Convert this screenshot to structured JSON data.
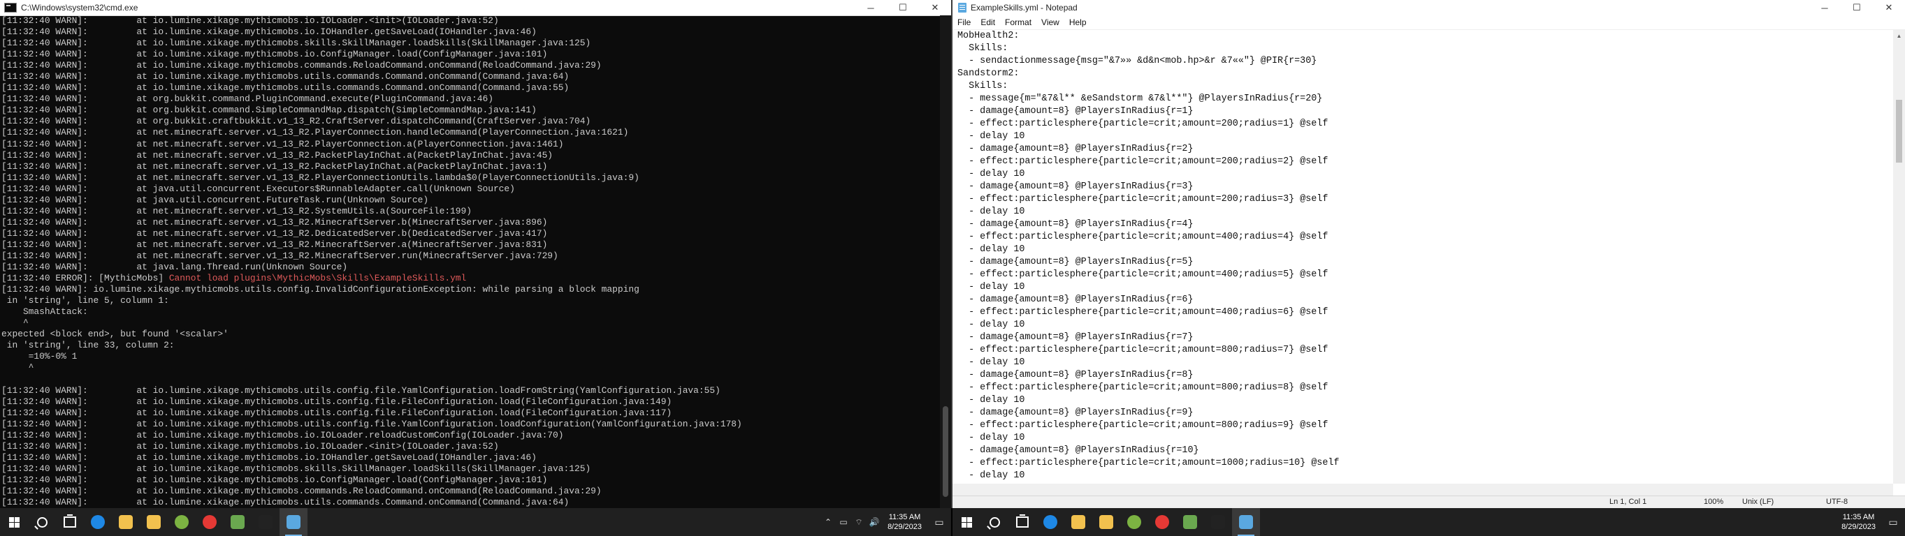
{
  "cmd": {
    "title": "C:\\Windows\\system32\\cmd.exe",
    "controls": {
      "minimize": "─",
      "maximize": "☐",
      "close": "✕"
    },
    "lines": [
      {
        "text": "[11:32:40 WARN]:         at io.lumine.xikage.mythicmobs.io.IOLoader.<init>(IOLoader.java:52)"
      },
      {
        "text": "[11:32:40 WARN]:         at io.lumine.xikage.mythicmobs.io.IOHandler.getSaveLoad(IOHandler.java:46)"
      },
      {
        "text": "[11:32:40 WARN]:         at io.lumine.xikage.mythicmobs.skills.SkillManager.loadSkills(SkillManager.java:125)"
      },
      {
        "text": "[11:32:40 WARN]:         at io.lumine.xikage.mythicmobs.io.ConfigManager.load(ConfigManager.java:101)"
      },
      {
        "text": "[11:32:40 WARN]:         at io.lumine.xikage.mythicmobs.commands.ReloadCommand.onCommand(ReloadCommand.java:29)"
      },
      {
        "text": "[11:32:40 WARN]:         at io.lumine.xikage.mythicmobs.utils.commands.Command.onCommand(Command.java:64)"
      },
      {
        "text": "[11:32:40 WARN]:         at io.lumine.xikage.mythicmobs.utils.commands.Command.onCommand(Command.java:55)"
      },
      {
        "text": "[11:32:40 WARN]:         at org.bukkit.command.PluginCommand.execute(PluginCommand.java:46)"
      },
      {
        "text": "[11:32:40 WARN]:         at org.bukkit.command.SimpleCommandMap.dispatch(SimpleCommandMap.java:141)"
      },
      {
        "text": "[11:32:40 WARN]:         at org.bukkit.craftbukkit.v1_13_R2.CraftServer.dispatchCommand(CraftServer.java:704)"
      },
      {
        "text": "[11:32:40 WARN]:         at net.minecraft.server.v1_13_R2.PlayerConnection.handleCommand(PlayerConnection.java:1621)"
      },
      {
        "text": "[11:32:40 WARN]:         at net.minecraft.server.v1_13_R2.PlayerConnection.a(PlayerConnection.java:1461)"
      },
      {
        "text": "[11:32:40 WARN]:         at net.minecraft.server.v1_13_R2.PacketPlayInChat.a(PacketPlayInChat.java:45)"
      },
      {
        "text": "[11:32:40 WARN]:         at net.minecraft.server.v1_13_R2.PacketPlayInChat.a(PacketPlayInChat.java:1)"
      },
      {
        "text": "[11:32:40 WARN]:         at net.minecraft.server.v1_13_R2.PlayerConnectionUtils.lambda$0(PlayerConnectionUtils.java:9)"
      },
      {
        "text": "[11:32:40 WARN]:         at java.util.concurrent.Executors$RunnableAdapter.call(Unknown Source)"
      },
      {
        "text": "[11:32:40 WARN]:         at java.util.concurrent.FutureTask.run(Unknown Source)"
      },
      {
        "text": "[11:32:40 WARN]:         at net.minecraft.server.v1_13_R2.SystemUtils.a(SourceFile:199)"
      },
      {
        "text": "[11:32:40 WARN]:         at net.minecraft.server.v1_13_R2.MinecraftServer.b(MinecraftServer.java:896)"
      },
      {
        "text": "[11:32:40 WARN]:         at net.minecraft.server.v1_13_R2.DedicatedServer.b(DedicatedServer.java:417)"
      },
      {
        "text": "[11:32:40 WARN]:         at net.minecraft.server.v1_13_R2.MinecraftServer.a(MinecraftServer.java:831)"
      },
      {
        "text": "[11:32:40 WARN]:         at net.minecraft.server.v1_13_R2.MinecraftServer.run(MinecraftServer.java:729)"
      },
      {
        "text": "[11:32:40 WARN]:         at java.lang.Thread.run(Unknown Source)"
      },
      {
        "text": "[11:32:40 ERROR]: [MythicMobs] ",
        "red": "Cannot load plugins\\MythicMobs\\Skills\\ExampleSkills.yml"
      },
      {
        "text": "[11:32:40 WARN]: io.lumine.xikage.mythicmobs.utils.config.InvalidConfigurationException: while parsing a block mapping"
      },
      {
        "text": " in 'string', line 5, column 1:"
      },
      {
        "text": "    SmashAttack:"
      },
      {
        "text": "    ^"
      },
      {
        "text": "expected <block end>, but found '<scalar>'"
      },
      {
        "text": " in 'string', line 33, column 2:"
      },
      {
        "text": "     =10%-0% 1"
      },
      {
        "text": "     ^"
      },
      {
        "text": ""
      },
      {
        "text": "[11:32:40 WARN]:         at io.lumine.xikage.mythicmobs.utils.config.file.YamlConfiguration.loadFromString(YamlConfiguration.java:55)"
      },
      {
        "text": "[11:32:40 WARN]:         at io.lumine.xikage.mythicmobs.utils.config.file.FileConfiguration.load(FileConfiguration.java:149)"
      },
      {
        "text": "[11:32:40 WARN]:         at io.lumine.xikage.mythicmobs.utils.config.file.FileConfiguration.load(FileConfiguration.java:117)"
      },
      {
        "text": "[11:32:40 WARN]:         at io.lumine.xikage.mythicmobs.utils.config.file.YamlConfiguration.loadConfiguration(YamlConfiguration.java:178)"
      },
      {
        "text": "[11:32:40 WARN]:         at io.lumine.xikage.mythicmobs.io.IOLoader.reloadCustomConfig(IOLoader.java:70)"
      },
      {
        "text": "[11:32:40 WARN]:         at io.lumine.xikage.mythicmobs.io.IOLoader.<init>(IOLoader.java:52)"
      },
      {
        "text": "[11:32:40 WARN]:         at io.lumine.xikage.mythicmobs.io.IOHandler.getSaveLoad(IOHandler.java:46)"
      },
      {
        "text": "[11:32:40 WARN]:         at io.lumine.xikage.mythicmobs.skills.SkillManager.loadSkills(SkillManager.java:125)"
      },
      {
        "text": "[11:32:40 WARN]:         at io.lumine.xikage.mythicmobs.io.ConfigManager.load(ConfigManager.java:101)"
      },
      {
        "text": "[11:32:40 WARN]:         at io.lumine.xikage.mythicmobs.commands.ReloadCommand.onCommand(ReloadCommand.java:29)"
      },
      {
        "text": "[11:32:40 WARN]:         at io.lumine.xikage.mythicmobs.utils.commands.Command.onCommand(Command.java:64)"
      }
    ]
  },
  "notepad": {
    "title": "ExampleSkills.yml - Notepad",
    "controls": {
      "minimize": "─",
      "maximize": "☐",
      "close": "✕"
    },
    "menu": [
      "File",
      "Edit",
      "Format",
      "View",
      "Help"
    ],
    "lines": [
      "MobHealth2:",
      "  Skills:",
      "  - sendactionmessage{msg=\"&7»» &d&n<mob.hp>&r &7««\"} @PIR{r=30}",
      "Sandstorm2:",
      "  Skills:",
      "  - message{m=\"&7&l** &eSandstorm &7&l**\"} @PlayersInRadius{r=20}",
      "  - damage{amount=8} @PlayersInRadius{r=1}",
      "  - effect:particlesphere{particle=crit;amount=200;radius=1} @self",
      "  - delay 10",
      "  - damage{amount=8} @PlayersInRadius{r=2}",
      "  - effect:particlesphere{particle=crit;amount=200;radius=2} @self",
      "  - delay 10",
      "  - damage{amount=8} @PlayersInRadius{r=3}",
      "  - effect:particlesphere{particle=crit;amount=200;radius=3} @self",
      "  - delay 10",
      "  - damage{amount=8} @PlayersInRadius{r=4}",
      "  - effect:particlesphere{particle=crit;amount=400;radius=4} @self",
      "  - delay 10",
      "  - damage{amount=8} @PlayersInRadius{r=5}",
      "  - effect:particlesphere{particle=crit;amount=400;radius=5} @self",
      "  - delay 10",
      "  - damage{amount=8} @PlayersInRadius{r=6}",
      "  - effect:particlesphere{particle=crit;amount=400;radius=6} @self",
      "  - delay 10",
      "  - damage{amount=8} @PlayersInRadius{r=7}",
      "  - effect:particlesphere{particle=crit;amount=800;radius=7} @self",
      "  - delay 10",
      "  - damage{amount=8} @PlayersInRadius{r=8}",
      "  - effect:particlesphere{particle=crit;amount=800;radius=8} @self",
      "  - delay 10",
      "  - damage{amount=8} @PlayersInRadius{r=9}",
      "  - effect:particlesphere{particle=crit;amount=800;radius=9} @self",
      "  - delay 10",
      "  - damage{amount=8} @PlayersInRadius{r=10}",
      "  - effect:particlesphere{particle=crit;amount=1000;radius=10} @self",
      "  - delay 10"
    ],
    "status": {
      "position": "Ln 1, Col 1",
      "zoom": "100%",
      "line_ending": "Unix (LF)",
      "encoding": "UTF-8"
    }
  },
  "taskbar": {
    "time": "11:35 AM",
    "date": "8/29/2023",
    "apps_left": [
      {
        "name": "edge-icon",
        "color": "#1e88e5",
        "shape": "circ"
      },
      {
        "name": "file-explorer-icon",
        "color": "#f2c14e",
        "shape": "sq"
      },
      {
        "name": "store-icon",
        "color": "#f2c14e",
        "shape": "sq"
      },
      {
        "name": "app-icon",
        "color": "#7cb342",
        "shape": "circ"
      },
      {
        "name": "chrome-icon",
        "color": "#e53935",
        "shape": "circ"
      },
      {
        "name": "minecraft-icon",
        "color": "#6aa84f",
        "shape": "sq"
      },
      {
        "name": "terminal-icon",
        "color": "#222222",
        "shape": "sq"
      },
      {
        "name": "notepad-icon",
        "color": "#5aa8e0",
        "shape": "sq"
      }
    ],
    "apps_right": [
      {
        "name": "edge-icon",
        "color": "#1e88e5",
        "shape": "circ"
      },
      {
        "name": "file-explorer-icon",
        "color": "#f2c14e",
        "shape": "sq"
      },
      {
        "name": "store-icon",
        "color": "#f2c14e",
        "shape": "sq"
      },
      {
        "name": "app-icon",
        "color": "#7cb342",
        "shape": "circ"
      },
      {
        "name": "chrome-icon",
        "color": "#e53935",
        "shape": "circ"
      },
      {
        "name": "minecraft-icon",
        "color": "#6aa84f",
        "shape": "sq"
      },
      {
        "name": "terminal-icon",
        "color": "#222222",
        "shape": "sq"
      },
      {
        "name": "notepad-icon",
        "color": "#5aa8e0",
        "shape": "sq"
      }
    ],
    "tray_glyphs": [
      "⌃",
      "▭",
      "⌔",
      "🔊"
    ],
    "notif_glyph": "▭"
  }
}
